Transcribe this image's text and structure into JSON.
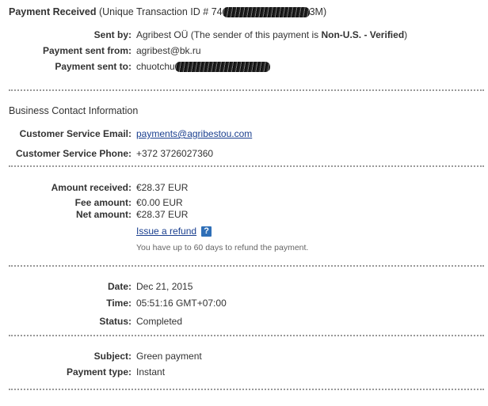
{
  "header": {
    "title": "Payment Received",
    "transaction_prefix": "(Unique Transaction ID # 74",
    "transaction_suffix": "3M)"
  },
  "sender": {
    "sent_by_label": "Sent by:",
    "sent_by_name": "Agribest OÜ",
    "sent_by_note_pre": "(The sender of this payment is",
    "sent_by_note_bold": "Non-U.S. - Verified",
    "sent_by_note_post": ")",
    "sent_from_label": "Payment sent from:",
    "sent_from_value": "agribest@bk.ru",
    "sent_to_label": "Payment sent to:",
    "sent_to_value": "chuotchu"
  },
  "business": {
    "title": "Business Contact Information",
    "email_label": "Customer Service Email:",
    "email_value": "payments@agribestou.com",
    "phone_label": "Customer Service Phone:",
    "phone_value": "+372 3726027360"
  },
  "amounts": {
    "received_label": "Amount received:",
    "received_value": "€28.37 EUR",
    "fee_label": "Fee amount:",
    "fee_value": "€0.00 EUR",
    "net_label": "Net amount:",
    "net_value": "€28.37 EUR",
    "refund_link": "Issue a refund",
    "help_icon": "?",
    "refund_note": "You have up to 60 days to refund the payment."
  },
  "details": {
    "date_label": "Date:",
    "date_value": "Dec 21, 2015",
    "time_label": "Time:",
    "time_value": "05:51:16 GMT+07:00",
    "status_label": "Status:",
    "status_value": "Completed"
  },
  "subject": {
    "subject_label": "Subject:",
    "subject_value": "Green payment",
    "type_label": "Payment type:",
    "type_value": "Instant"
  }
}
